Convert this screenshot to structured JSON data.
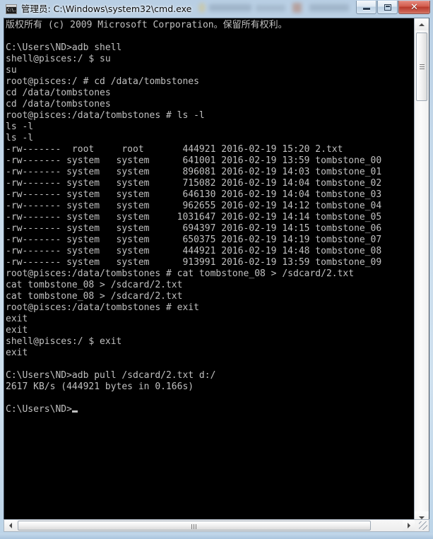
{
  "window": {
    "title": "管理员: C:\\Windows\\system32\\cmd.exe",
    "icon_text": "C:\\.",
    "icon_name": "cmd-console-icon",
    "buttons": {
      "minimize": "minimize",
      "maximize": "maximize",
      "close": "✕"
    }
  },
  "console": {
    "background_color": "#000000",
    "text_color": "#c0c0c0",
    "lines": [
      "版权所有 (c) 2009 Microsoft Corporation。保留所有权利。",
      "",
      "C:\\Users\\ND>adb shell",
      "shell@pisces:/ $ su",
      "su",
      "root@pisces:/ # cd /data/tombstones",
      "cd /data/tombstones",
      "cd /data/tombstones",
      "root@pisces:/data/tombstones # ls -l",
      "ls -l",
      "ls -l",
      "-rw-------  root     root       444921 2016-02-19 15:20 2.txt",
      "-rw------- system   system      641001 2016-02-19 13:59 tombstone_00",
      "-rw------- system   system      896081 2016-02-19 14:03 tombstone_01",
      "-rw------- system   system      715082 2016-02-19 14:04 tombstone_02",
      "-rw------- system   system      646130 2016-02-19 14:04 tombstone_03",
      "-rw------- system   system      962655 2016-02-19 14:12 tombstone_04",
      "-rw------- system   system     1031647 2016-02-19 14:14 tombstone_05",
      "-rw------- system   system      694397 2016-02-19 14:15 tombstone_06",
      "-rw------- system   system      650375 2016-02-19 14:19 tombstone_07",
      "-rw------- system   system      444921 2016-02-19 14:48 tombstone_08",
      "-rw------- system   system      913991 2016-02-19 13:59 tombstone_09",
      "root@pisces:/data/tombstones # cat tombstone_08 > /sdcard/2.txt",
      "cat tombstone_08 > /sdcard/2.txt",
      "cat tombstone_08 > /sdcard/2.txt",
      "root@pisces:/data/tombstones # exit",
      "exit",
      "exit",
      "shell@pisces:/ $ exit",
      "exit",
      "",
      "C:\\Users\\ND>adb pull /sdcard/2.txt d:/",
      "2617 KB/s (444921 bytes in 0.166s)",
      "",
      "C:\\Users\\ND>"
    ],
    "prompt_last": "C:\\Users\\ND>",
    "cursor": "_"
  },
  "scrollbars": {
    "vertical": {
      "up_arrow": "▲",
      "down_arrow": "▼",
      "thumb_name": "vertical-scroll-thumb"
    },
    "horizontal": {
      "left_arrow": "◀",
      "right_arrow": "▶",
      "thumb_name": "horizontal-scroll-thumb"
    }
  }
}
